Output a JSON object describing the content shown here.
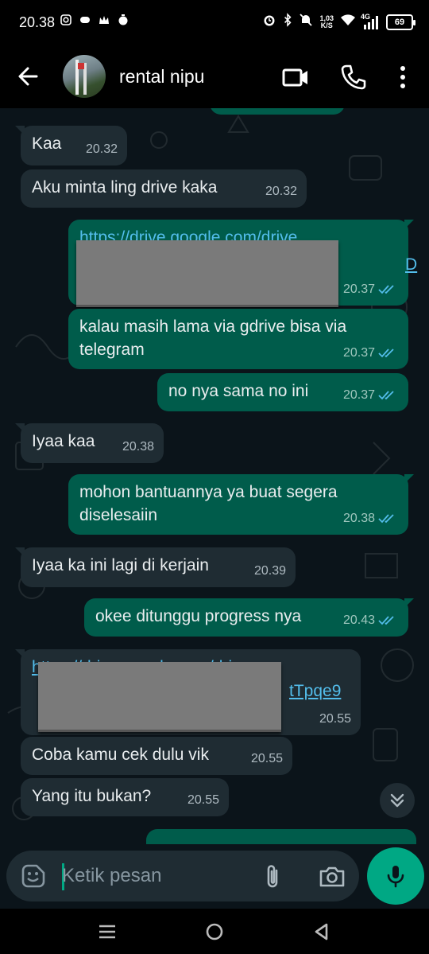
{
  "status_bar": {
    "time": "20.38",
    "speed_value": "1,03",
    "speed_unit": "K/S",
    "network": "4G",
    "battery": "69"
  },
  "header": {
    "contact_name": "rental nipu",
    "icons": [
      "back-arrow-icon",
      "video-call-icon",
      "phone-icon",
      "more-options-icon"
    ]
  },
  "messages": [
    {
      "direction": "in",
      "text": "Kaa",
      "time": "20.32"
    },
    {
      "direction": "in",
      "text": "Aku minta ling drive kaka",
      "time": "20.32"
    },
    {
      "direction": "out",
      "text": "https://drive.google.com/drive",
      "link_tail": "D",
      "time": "20.37",
      "redacted": true
    },
    {
      "direction": "out",
      "text": "kalau masih lama via gdrive bisa via telegram",
      "time": "20.37"
    },
    {
      "direction": "out",
      "text": "no nya sama no ini",
      "time": "20.37"
    },
    {
      "direction": "in",
      "text": "Iyaa kaa",
      "time": "20.38"
    },
    {
      "direction": "out",
      "text": "mohon bantuannya ya buat segera diselesaiin",
      "time": "20.38"
    },
    {
      "direction": "in",
      "text": "Iyaa ka ini lagi di kerjain",
      "time": "20.39"
    },
    {
      "direction": "out",
      "text": "okee ditunggu progress nya",
      "time": "20.43"
    },
    {
      "direction": "in",
      "text": "https://drive.google.com/drive",
      "link_mid": "tTpqe9",
      "time": "20.55",
      "redacted": true
    },
    {
      "direction": "in",
      "text": "Coba kamu cek dulu vik",
      "time": "20.55"
    },
    {
      "direction": "in",
      "text": "Yang itu bukan?",
      "time": "20.55"
    }
  ],
  "input": {
    "placeholder": "Ketik pesan"
  },
  "colors": {
    "incoming_bubble": "#1f2c33",
    "outgoing_bubble": "#005c4b",
    "accent": "#00a884",
    "link": "#53bdeb",
    "read_ticks": "#53bdeb"
  }
}
